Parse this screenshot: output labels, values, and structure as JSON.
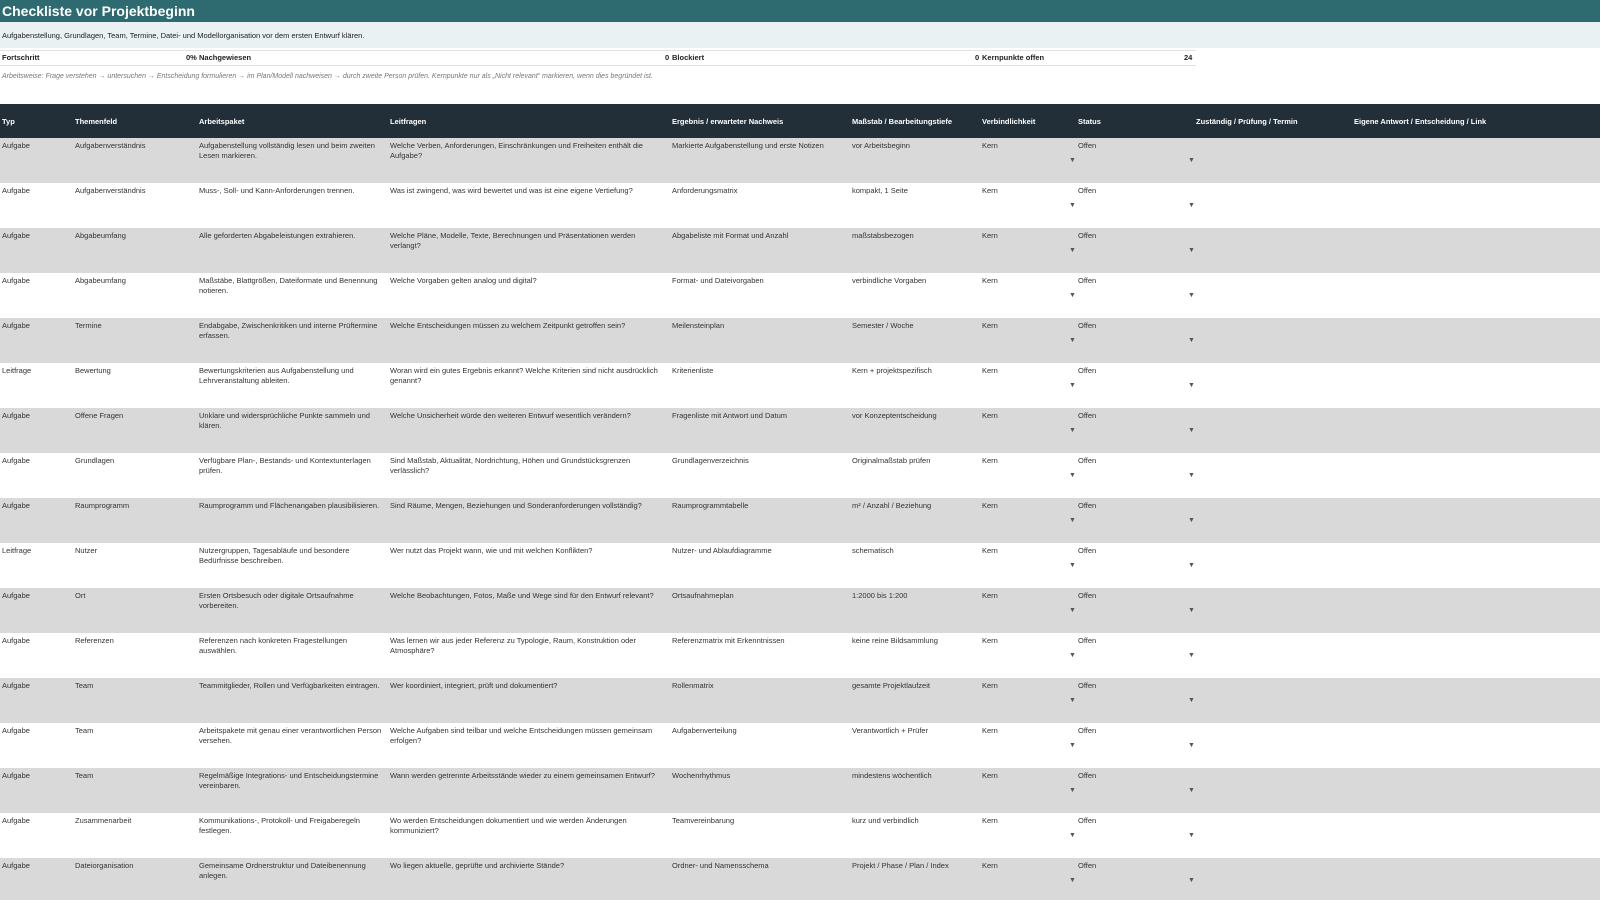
{
  "sheet": {
    "title": "Checkliste vor Projektbeginn",
    "description": "Aufgabenstellung, Grundlagen, Team, Termine, Datei- und Modellorganisation vor dem ersten Entwurf klären.",
    "stats": {
      "fortschritt_label": "Fortschritt",
      "fortschritt_value": "0%",
      "nachgewiesen_label": "Nachgewiesen",
      "nachgewiesen_value": "0",
      "blockiert_label": "Blockiert",
      "blockiert_value": "0",
      "kernpunkte_label": "Kernpunkte offen",
      "kernpunkte_value": "24"
    },
    "method_note": "Arbeitsweise: Frage verstehen → untersuchen → Entscheidung formulieren → im Plan/Modell nachweisen → durch zweite Person prüfen. Kernpunkte nur als „Nicht relevant“ markieren, wenn dies begründet ist."
  },
  "columns": {
    "typ": "Typ",
    "themenfeld": "Themenfeld",
    "arbeitspaket": "Arbeitspaket",
    "leitfragen": "Leitfragen",
    "ergebnis": "Ergebnis / erwarteter Nachweis",
    "massstab": "Maßstab / Bearbeitungstiefe",
    "verbindlichkeit": "Verbindlichkeit",
    "status": "Status",
    "zustaendig": "Zuständig / Prüfung / Termin",
    "eigene": "Eigene Antwort / Entscheidung / Link"
  },
  "dropdown_icon": "triangle-down-icon",
  "colors": {
    "title_bar": "#2e6b70",
    "desc_bar": "#e9f1f2",
    "header": "#222f38",
    "row_shade": "#d9d9d9"
  },
  "rows": [
    {
      "typ": "Aufgabe",
      "thema": "Aufgabenverständnis",
      "paket": "Aufgabenstellung vollständig lesen und beim zweiten Lesen markieren.",
      "leit": "Welche Verben, Anforderungen, Einschränkungen und Freiheiten enthält die Aufgabe?",
      "erg": "Markierte Aufgabenstellung und erste Notizen",
      "mass": "vor Arbeitsbeginn",
      "verb": "Kern",
      "status": "Offen"
    },
    {
      "typ": "Aufgabe",
      "thema": "Aufgabenverständnis",
      "paket": "Muss-, Soll- und Kann-Anforderungen trennen.",
      "leit": "Was ist zwingend, was wird bewertet und was ist eine eigene Vertiefung?",
      "erg": "Anforderungsmatrix",
      "mass": "kompakt, 1 Seite",
      "verb": "Kern",
      "status": "Offen"
    },
    {
      "typ": "Aufgabe",
      "thema": "Abgabeumfang",
      "paket": "Alle geforderten Abgabeleistungen extrahieren.",
      "leit": "Welche Pläne, Modelle, Texte, Berechnungen und Präsentationen werden verlangt?",
      "erg": "Abgabeliste mit Format und Anzahl",
      "mass": "maßstabsbezogen",
      "verb": "Kern",
      "status": "Offen"
    },
    {
      "typ": "Aufgabe",
      "thema": "Abgabeumfang",
      "paket": "Maßstäbe, Blattgrößen, Dateiformate und Benennung notieren.",
      "leit": "Welche Vorgaben gelten analog und digital?",
      "erg": "Format- und Dateivorgaben",
      "mass": "verbindliche Vorgaben",
      "verb": "Kern",
      "status": "Offen"
    },
    {
      "typ": "Aufgabe",
      "thema": "Termine",
      "paket": "Endabgabe, Zwischenkritiken und interne Prüftermine erfassen.",
      "leit": "Welche Entscheidungen müssen zu welchem Zeitpunkt getroffen sein?",
      "erg": "Meilensteinplan",
      "mass": "Semester / Woche",
      "verb": "Kern",
      "status": "Offen"
    },
    {
      "typ": "Leitfrage",
      "thema": "Bewertung",
      "paket": "Bewertungskriterien aus Aufgabenstellung und Lehrveranstaltung ableiten.",
      "leit": "Woran wird ein gutes Ergebnis erkannt? Welche Kriterien sind nicht ausdrücklich genannt?",
      "erg": "Kriterienliste",
      "mass": "Kern + projektspezifisch",
      "verb": "Kern",
      "status": "Offen"
    },
    {
      "typ": "Aufgabe",
      "thema": "Offene Fragen",
      "paket": "Unklare und widersprüchliche Punkte sammeln und klären.",
      "leit": "Welche Unsicherheit würde den weiteren Entwurf wesentlich verändern?",
      "erg": "Fragenliste mit Antwort und Datum",
      "mass": "vor Konzeptentscheidung",
      "verb": "Kern",
      "status": "Offen"
    },
    {
      "typ": "Aufgabe",
      "thema": "Grundlagen",
      "paket": "Verfügbare Plan-, Bestands- und Kontextunterlagen prüfen.",
      "leit": "Sind Maßstab, Aktualität, Nordrichtung, Höhen und Grundstücksgrenzen verlässlich?",
      "erg": "Grundlagenverzeichnis",
      "mass": "Originalmaßstab prüfen",
      "verb": "Kern",
      "status": "Offen"
    },
    {
      "typ": "Aufgabe",
      "thema": "Raumprogramm",
      "paket": "Raumprogramm und Flächenangaben plausibilisieren.",
      "leit": "Sind Räume, Mengen, Beziehungen und Sonderanforderungen vollständig?",
      "erg": "Raumprogrammtabelle",
      "mass": "m² / Anzahl / Beziehung",
      "verb": "Kern",
      "status": "Offen"
    },
    {
      "typ": "Leitfrage",
      "thema": "Nutzer",
      "paket": "Nutzergruppen, Tagesabläufe und besondere Bedürfnisse beschreiben.",
      "leit": "Wer nutzt das Projekt wann, wie und mit welchen Konflikten?",
      "erg": "Nutzer- und Ablaufdiagramme",
      "mass": "schematisch",
      "verb": "Kern",
      "status": "Offen"
    },
    {
      "typ": "Aufgabe",
      "thema": "Ort",
      "paket": "Ersten Ortsbesuch oder digitale Ortsaufnahme vorbereiten.",
      "leit": "Welche Beobachtungen, Fotos, Maße und Wege sind für den Entwurf relevant?",
      "erg": "Ortsaufnahmeplan",
      "mass": "1:2000 bis 1:200",
      "verb": "Kern",
      "status": "Offen"
    },
    {
      "typ": "Aufgabe",
      "thema": "Referenzen",
      "paket": "Referenzen nach konkreten Fragestellungen auswählen.",
      "leit": "Was lernen wir aus jeder Referenz zu Typologie, Raum, Konstruktion oder Atmosphäre?",
      "erg": "Referenzmatrix mit Erkenntnissen",
      "mass": "keine reine Bildsammlung",
      "verb": "Kern",
      "status": "Offen"
    },
    {
      "typ": "Aufgabe",
      "thema": "Team",
      "paket": "Teammitglieder, Rollen und Verfügbarkeiten eintragen.",
      "leit": "Wer koordiniert, integriert, prüft und dokumentiert?",
      "erg": "Rollenmatrix",
      "mass": "gesamte Projektlaufzeit",
      "verb": "Kern",
      "status": "Offen"
    },
    {
      "typ": "Aufgabe",
      "thema": "Team",
      "paket": "Arbeitspakete mit genau einer verantwortlichen Person versehen.",
      "leit": "Welche Aufgaben sind teilbar und welche Entscheidungen müssen gemeinsam erfolgen?",
      "erg": "Aufgabenverteilung",
      "mass": "Verantwortlich + Prüfer",
      "verb": "Kern",
      "status": "Offen"
    },
    {
      "typ": "Aufgabe",
      "thema": "Team",
      "paket": "Regelmäßige Integrations- und Entscheidungstermine vereinbaren.",
      "leit": "Wann werden getrennte Arbeitsstände wieder zu einem gemeinsamen Entwurf?",
      "erg": "Wochenrhythmus",
      "mass": "mindestens wöchentlich",
      "verb": "Kern",
      "status": "Offen"
    },
    {
      "typ": "Aufgabe",
      "thema": "Zusammenarbeit",
      "paket": "Kommunikations-, Protokoll- und Freigaberegeln festlegen.",
      "leit": "Wo werden Entscheidungen dokumentiert und wie werden Änderungen kommuniziert?",
      "erg": "Teamvereinbarung",
      "mass": "kurz und verbindlich",
      "verb": "Kern",
      "status": "Offen"
    },
    {
      "typ": "Aufgabe",
      "thema": "Dateiorganisation",
      "paket": "Gemeinsame Ordnerstruktur und Dateibenennung anlegen.",
      "leit": "Wo liegen aktuelle, geprüfte und archivierte Stände?",
      "erg": "Ordner- und Namensschema",
      "mass": "Projekt / Phase / Plan / Index",
      "verb": "Kern",
      "status": "Offen"
    }
  ]
}
